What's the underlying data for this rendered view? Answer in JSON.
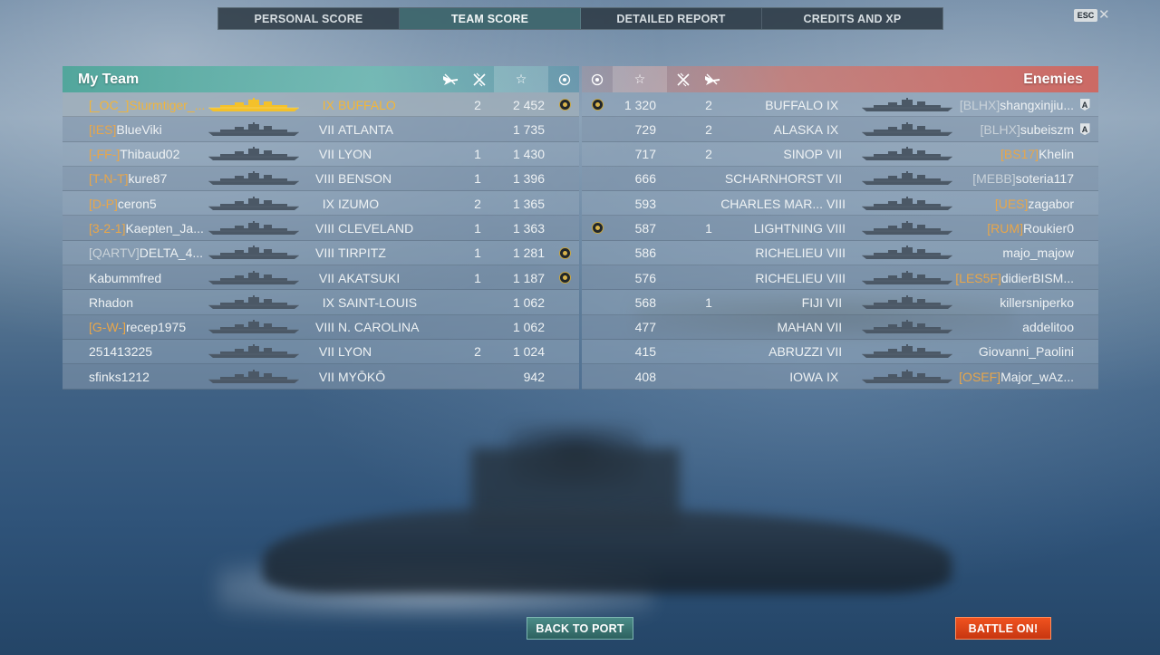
{
  "tabs": [
    {
      "label": "PERSONAL SCORE",
      "active": false
    },
    {
      "label": "TEAM SCORE",
      "active": true
    },
    {
      "label": "DETAILED REPORT",
      "active": false
    },
    {
      "label": "CREDITS AND XP",
      "active": false
    }
  ],
  "esc_label": "ESC",
  "close_glyph": "✕",
  "colors": {
    "my_team_accent": "#46a596",
    "enemy_accent": "#d75f55",
    "clan_tag": "#e8a64a",
    "highlight_player": "#f1b53b",
    "battle_button": "#e0451a",
    "back_button": "#3d7875"
  },
  "my_team": {
    "title": "My Team",
    "header_icons": [
      "plane-destroyed-icon",
      "ship-destroyed-icon",
      "star-icon",
      "medal-icon"
    ],
    "star_glyph": "☆",
    "rows": [
      {
        "clan": "[_OC_]",
        "clan_style": "orange",
        "player": "Sturmtiger_...",
        "tier": "IX",
        "ship": "BUFFALO",
        "c1": "",
        "c2": "2",
        "score": "2 452",
        "medal": true,
        "highlight": true
      },
      {
        "clan": "[IES]",
        "clan_style": "orange",
        "player": "BlueViki",
        "tier": "VII",
        "ship": "ATLANTA",
        "c1": "",
        "c2": "",
        "score": "1 735",
        "medal": false
      },
      {
        "clan": "[-FF-]",
        "clan_style": "orange",
        "player": "Thibaud02",
        "tier": "VII",
        "ship": "LYON",
        "c1": "",
        "c2": "1",
        "score": "1 430",
        "medal": false
      },
      {
        "clan": "[T-N-T]",
        "clan_style": "orange",
        "player": "kure87",
        "tier": "VIII",
        "ship": "BENSON",
        "c1": "",
        "c2": "1",
        "score": "1 396",
        "medal": false
      },
      {
        "clan": "[D-P]",
        "clan_style": "orange",
        "player": "ceron5",
        "tier": "IX",
        "ship": "IZUMO",
        "c1": "",
        "c2": "2",
        "score": "1 365",
        "medal": false
      },
      {
        "clan": "[3-2-1]",
        "clan_style": "orange",
        "player": "Kaepten_Ja...",
        "tier": "VIII",
        "ship": "CLEVELAND",
        "c1": "",
        "c2": "1",
        "score": "1 363",
        "medal": false
      },
      {
        "clan": "[QARTV]",
        "clan_style": "grey",
        "player": "DELTA_4...",
        "tier": "VIII",
        "ship": "TIRPITZ",
        "c1": "",
        "c2": "1",
        "score": "1 281",
        "medal": true
      },
      {
        "clan": "",
        "clan_style": "none",
        "player": "Kabummfred",
        "tier": "VII",
        "ship": "AKATSUKI",
        "c1": "",
        "c2": "1",
        "score": "1 187",
        "medal": true
      },
      {
        "clan": "",
        "clan_style": "none",
        "player": "Rhadon",
        "tier": "IX",
        "ship": "SAINT-LOUIS",
        "c1": "",
        "c2": "",
        "score": "1 062",
        "medal": false
      },
      {
        "clan": "[G-W-]",
        "clan_style": "orange",
        "player": "recep1975",
        "tier": "VIII",
        "ship": "N. CAROLINA",
        "c1": "",
        "c2": "",
        "score": "1 062",
        "medal": false
      },
      {
        "clan": "",
        "clan_style": "none",
        "player": "251413225",
        "tier": "VII",
        "ship": "LYON",
        "c1": "",
        "c2": "2",
        "score": "1 024",
        "medal": false
      },
      {
        "clan": "",
        "clan_style": "none",
        "player": "sfinks1212",
        "tier": "VII",
        "ship": "MYŌKŌ",
        "c1": "",
        "c2": "",
        "score": "942",
        "medal": false
      }
    ]
  },
  "enemies": {
    "title": "Enemies",
    "header_icons": [
      "medal-icon",
      "star-icon",
      "ship-destroyed-icon",
      "plane-destroyed-icon"
    ],
    "star_glyph": "☆",
    "rows": [
      {
        "medal": true,
        "score": "1 320",
        "c2": "2",
        "c1": "",
        "ship": "BUFFALO",
        "tier": "IX",
        "clan": "[BLHX]",
        "clan_style": "grey",
        "player": "shangxinjiu...",
        "division": "A"
      },
      {
        "medal": false,
        "score": "729",
        "c2": "2",
        "c1": "",
        "ship": "ALASKA",
        "tier": "IX",
        "clan": "[BLHX]",
        "clan_style": "grey",
        "player": "subeiszm",
        "division": "A"
      },
      {
        "medal": false,
        "score": "717",
        "c2": "2",
        "c1": "",
        "ship": "SINOP",
        "tier": "VII",
        "clan": "[BS17]",
        "clan_style": "orange",
        "player": "Khelin",
        "division": ""
      },
      {
        "medal": false,
        "score": "666",
        "c2": "",
        "c1": "",
        "ship": "SCHARNHORST",
        "tier": "VII",
        "clan": "[MEBB]",
        "clan_style": "grey",
        "player": "soteria117",
        "division": ""
      },
      {
        "medal": false,
        "score": "593",
        "c2": "",
        "c1": "",
        "ship": "CHARLES MAR...",
        "tier": "VIII",
        "clan": "[UES]",
        "clan_style": "orange",
        "player": "zagabor",
        "division": ""
      },
      {
        "medal": true,
        "score": "587",
        "c2": "1",
        "c1": "",
        "ship": "LIGHTNING",
        "tier": "VIII",
        "clan": "[RUM]",
        "clan_style": "orange",
        "player": "Roukier0",
        "division": ""
      },
      {
        "medal": false,
        "score": "586",
        "c2": "",
        "c1": "",
        "ship": "RICHELIEU",
        "tier": "VIII",
        "clan": "",
        "clan_style": "none",
        "player": "majo_majow",
        "division": ""
      },
      {
        "medal": false,
        "score": "576",
        "c2": "",
        "c1": "",
        "ship": "RICHELIEU",
        "tier": "VIII",
        "clan": "[LES5F]",
        "clan_style": "orange",
        "player": "didierBISM...",
        "division": ""
      },
      {
        "medal": false,
        "score": "568",
        "c2": "1",
        "c1": "",
        "ship": "FIJI",
        "tier": "VII",
        "clan": "",
        "clan_style": "none",
        "player": "killersniperko",
        "division": ""
      },
      {
        "medal": false,
        "score": "477",
        "c2": "",
        "c1": "",
        "ship": "MAHAN",
        "tier": "VII",
        "clan": "",
        "clan_style": "none",
        "player": "addelitoo",
        "division": ""
      },
      {
        "medal": false,
        "score": "415",
        "c2": "",
        "c1": "",
        "ship": "ABRUZZI",
        "tier": "VII",
        "clan": "",
        "clan_style": "none",
        "player": "Giovanni_Paolini",
        "division": ""
      },
      {
        "medal": false,
        "score": "408",
        "c2": "",
        "c1": "",
        "ship": "IOWA",
        "tier": "IX",
        "clan": "[OSEF]",
        "clan_style": "orange",
        "player": "Major_wAz...",
        "division": ""
      }
    ]
  },
  "buttons": {
    "back_to_port": "BACK TO PORT",
    "battle_on": "BATTLE ON!"
  }
}
